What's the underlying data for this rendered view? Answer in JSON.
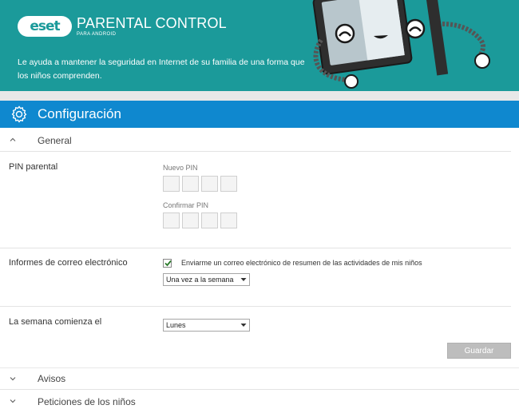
{
  "banner": {
    "brand": "eset",
    "product_title": "PARENTAL CONTROL",
    "product_subtitle": "PARA ANDROID",
    "tagline": "Le ayuda a mantener la seguridad en Internet de su familia de una forma que los niños comprenden."
  },
  "config": {
    "title": "Configuración",
    "icon": "gear-icon"
  },
  "sections": {
    "general": {
      "title": "General",
      "icon": "chevron-up-icon"
    },
    "avisos": {
      "title": "Avisos",
      "icon": "chevron-down-icon"
    },
    "peticiones": {
      "title": "Peticiones de los niños",
      "icon": "chevron-down-icon"
    }
  },
  "pin": {
    "label": "PIN parental",
    "new_label": "Nuevo PIN",
    "confirm_label": "Confirmar PIN",
    "digits": 4
  },
  "email": {
    "label": "Informes de correo electrónico",
    "checkbox_text": "Enviarme un correo electrónico de resumen de las actividades de mis niños",
    "checked": true,
    "frequency_selected": "Una vez a la semana"
  },
  "week": {
    "label": "La semana comienza el",
    "selected": "Lunes"
  },
  "save_label": "Guardar",
  "colors": {
    "banner": "#1b9a9a",
    "header": "#0f88cf",
    "check": "#2a7a2a"
  }
}
